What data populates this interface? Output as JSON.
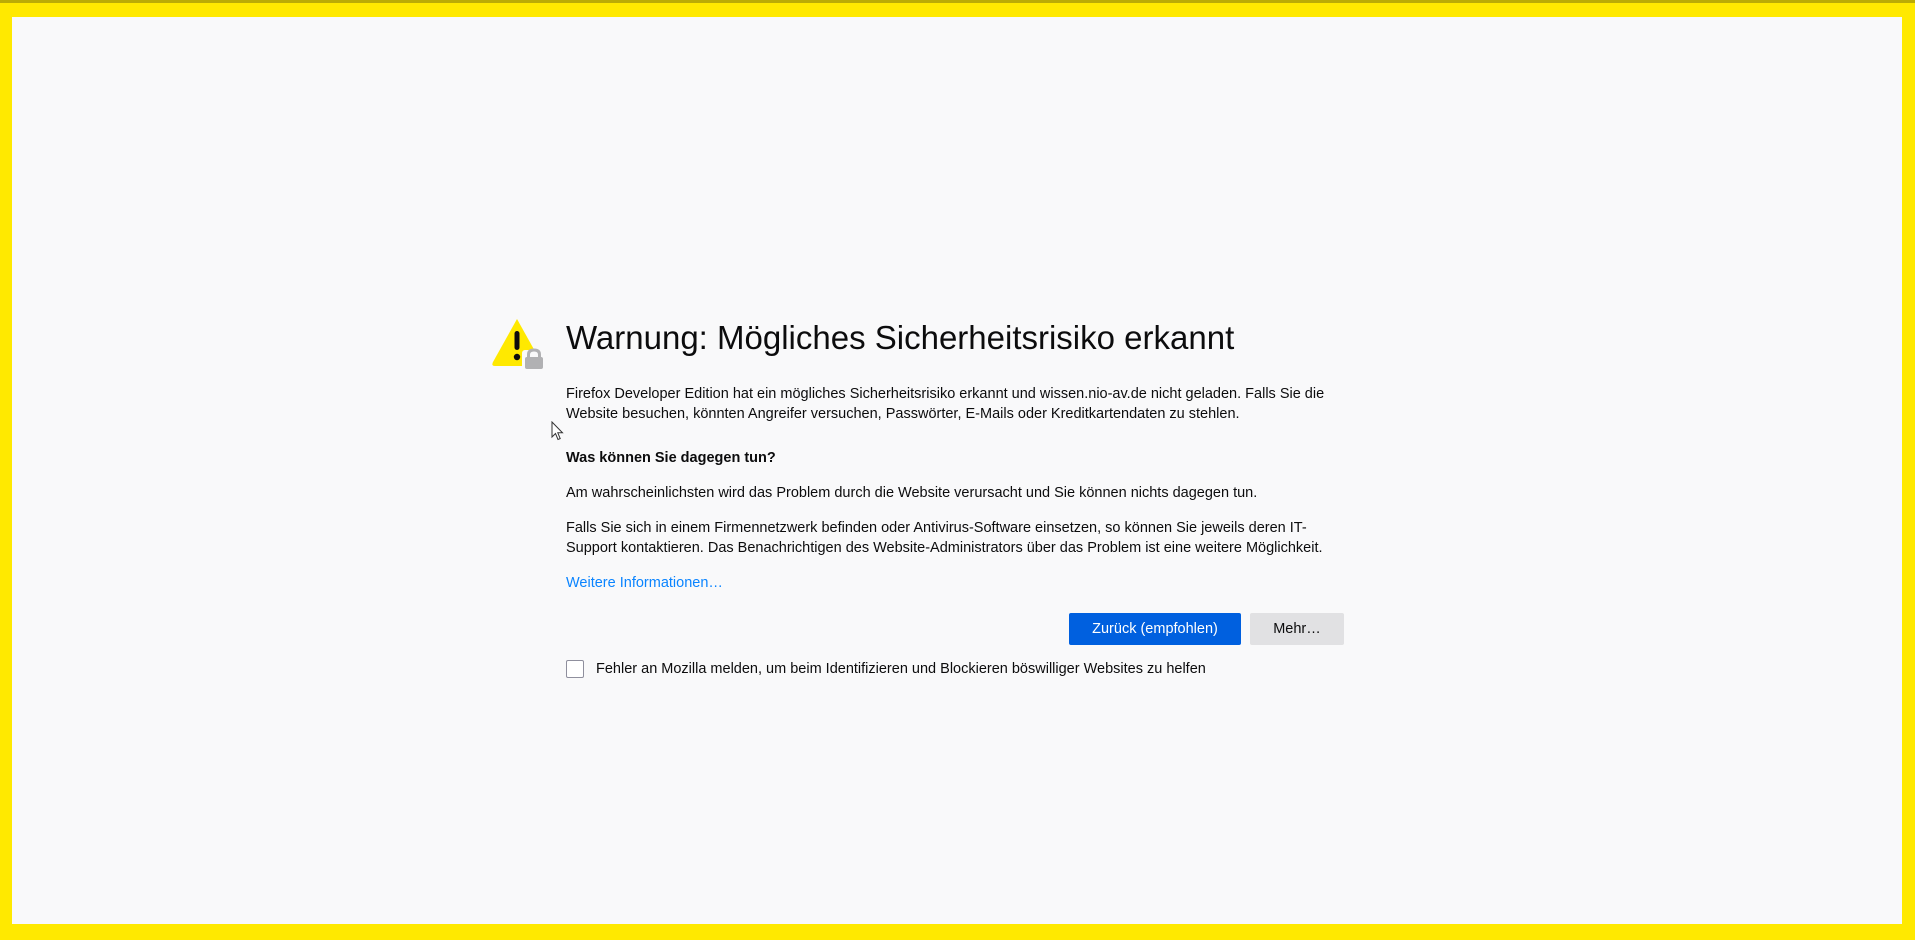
{
  "page": {
    "title": "Warnung: Mögliches Sicherheitsrisiko erkannt",
    "intro": "Firefox Developer Edition hat ein mögliches Sicherheitsrisiko erkannt und wissen.nio-av.de nicht geladen. Falls Sie die Website besuchen, könnten Angreifer versuchen, Passwörter, E-Mails oder Kreditkartendaten zu stehlen.",
    "what_heading": "Was können Sie dagegen tun?",
    "para1": "Am wahrscheinlichsten wird das Problem durch die Website verursacht und Sie können nichts dagegen tun.",
    "para2": "Falls Sie sich in einem Firmennetzwerk befinden oder Antivirus-Software einsetzen, so können Sie jeweils deren IT-Support kontaktieren. Das Benachrichtigen des Website-Administrators über das Problem ist eine weitere Möglichkeit.",
    "learn_more": "Weitere Informationen…"
  },
  "buttons": {
    "back_label": "Zurück (empfohlen)",
    "advanced_label": "Mehr…"
  },
  "report": {
    "checked": false,
    "label": "Fehler an Mozilla melden, um beim Identifizieren und Blockieren böswilliger Websites zu helfen"
  },
  "icons": {
    "warning": "warning-lock-icon",
    "cursor": "mouse-pointer-icon"
  },
  "colors": {
    "frame_border": "#ffe900",
    "page_background": "#f9f9fa",
    "primary_button": "#0060df",
    "secondary_button": "#e1e1e3",
    "link": "#0a84ff",
    "warning_yellow": "#ffe900"
  }
}
